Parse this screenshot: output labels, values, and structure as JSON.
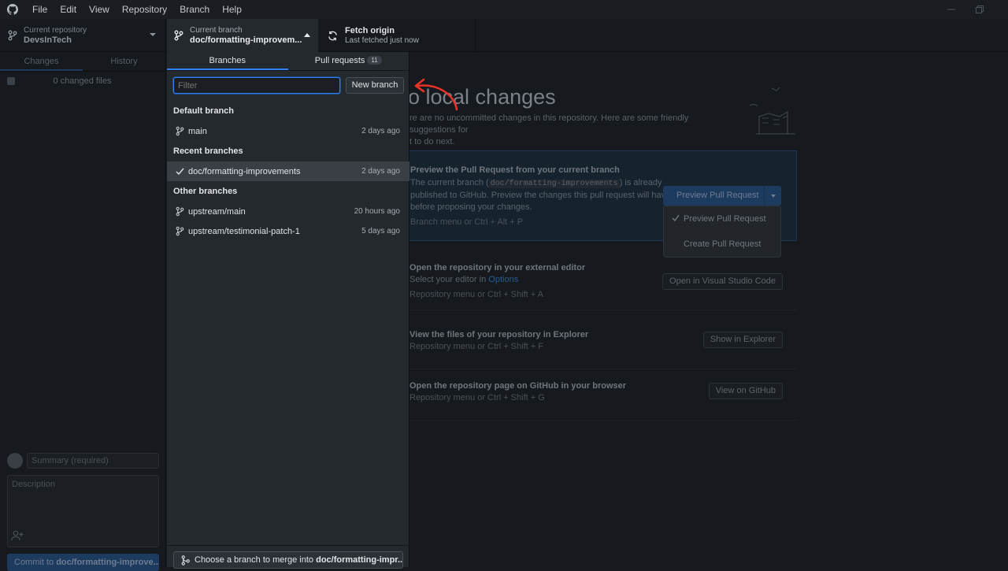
{
  "menu": [
    "File",
    "Edit",
    "View",
    "Repository",
    "Branch",
    "Help"
  ],
  "toolbar": {
    "repo_label": "Current repository",
    "repo_name": "DevsInTech",
    "branch_label": "Current branch",
    "branch_name": "doc/formatting-improvem...",
    "fetch_title": "Fetch origin",
    "fetch_sub": "Last fetched just now"
  },
  "sidebar": {
    "tabs": [
      "Changes",
      "History"
    ],
    "changed_files": "0 changed files",
    "summary_placeholder": "Summary (required)",
    "description_placeholder": "Description",
    "commit_prefix": "Commit to ",
    "commit_branch": "doc/formatting-improve..."
  },
  "main": {
    "title": "o local changes",
    "subtitle_1": "re are no uncommitted changes in this repository. Here are some friendly suggestions for",
    "subtitle_2": "t to do next.",
    "pr_card": {
      "title": "Preview the Pull Request from your current branch",
      "desc_pre": "The current branch (",
      "branch_code": "doc/formatting-improvements",
      "desc_post": ") is already",
      "desc_2": "published to GitHub. Preview the changes this pull request will have",
      "desc_3": "before proposing your changes.",
      "hint": "Branch menu or  Ctrl + Alt + P",
      "button": "Preview Pull Request",
      "menu_items": [
        "Preview Pull Request",
        "Create Pull Request"
      ]
    },
    "editor_card": {
      "title": "Open the repository in your external editor",
      "desc_pre": "Select your editor in ",
      "desc_link": "Options",
      "hint": "Repository menu or  Ctrl + Shift + A",
      "button": "Open in Visual Studio Code"
    },
    "explorer_card": {
      "title": "View the files of your repository in Explorer",
      "hint": "Repository menu or  Ctrl + Shift + F",
      "button": "Show in Explorer"
    },
    "github_card": {
      "title": "Open the repository page on GitHub in your browser",
      "hint": "Repository menu or  Ctrl + Shift + G",
      "button": "View on GitHub"
    }
  },
  "dropdown": {
    "tabs": {
      "branches": "Branches",
      "pull_requests": "Pull requests",
      "pr_count": "11"
    },
    "filter_placeholder": "Filter",
    "new_branch": "New branch",
    "groups": {
      "default": "Default branch",
      "recent": "Recent branches",
      "other": "Other branches"
    },
    "branches": {
      "main": {
        "name": "main",
        "when": "2 days ago"
      },
      "current": {
        "name": "doc/formatting-improvements",
        "when": "2 days ago"
      },
      "upstream_main": {
        "name": "upstream/main",
        "when": "20 hours ago"
      },
      "upstream_patch": {
        "name": "upstream/testimonial-patch-1",
        "when": "5 days ago"
      }
    },
    "merge_prefix": "Choose a branch to merge into ",
    "merge_branch": "doc/formatting-impr..."
  },
  "colors": {
    "accent": "#2f81f7",
    "annotation_arrow": "#e5332a"
  }
}
